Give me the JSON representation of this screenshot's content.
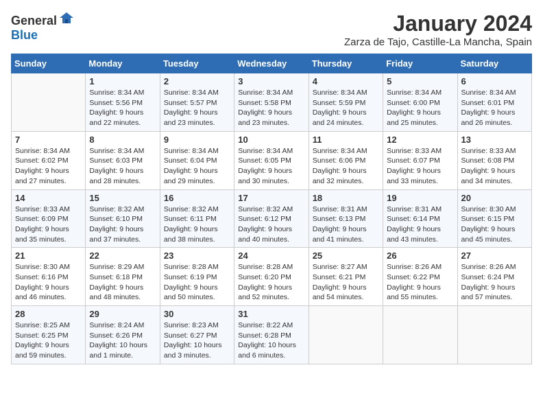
{
  "logo": {
    "general": "General",
    "blue": "Blue"
  },
  "title": "January 2024",
  "location": "Zarza de Tajo, Castille-La Mancha, Spain",
  "weekdays": [
    "Sunday",
    "Monday",
    "Tuesday",
    "Wednesday",
    "Thursday",
    "Friday",
    "Saturday"
  ],
  "weeks": [
    [
      {
        "day": "",
        "sunrise": "",
        "sunset": "",
        "daylight": ""
      },
      {
        "day": "1",
        "sunrise": "Sunrise: 8:34 AM",
        "sunset": "Sunset: 5:56 PM",
        "daylight": "Daylight: 9 hours and 22 minutes."
      },
      {
        "day": "2",
        "sunrise": "Sunrise: 8:34 AM",
        "sunset": "Sunset: 5:57 PM",
        "daylight": "Daylight: 9 hours and 23 minutes."
      },
      {
        "day": "3",
        "sunrise": "Sunrise: 8:34 AM",
        "sunset": "Sunset: 5:58 PM",
        "daylight": "Daylight: 9 hours and 23 minutes."
      },
      {
        "day": "4",
        "sunrise": "Sunrise: 8:34 AM",
        "sunset": "Sunset: 5:59 PM",
        "daylight": "Daylight: 9 hours and 24 minutes."
      },
      {
        "day": "5",
        "sunrise": "Sunrise: 8:34 AM",
        "sunset": "Sunset: 6:00 PM",
        "daylight": "Daylight: 9 hours and 25 minutes."
      },
      {
        "day": "6",
        "sunrise": "Sunrise: 8:34 AM",
        "sunset": "Sunset: 6:01 PM",
        "daylight": "Daylight: 9 hours and 26 minutes."
      }
    ],
    [
      {
        "day": "7",
        "sunrise": "Sunrise: 8:34 AM",
        "sunset": "Sunset: 6:02 PM",
        "daylight": "Daylight: 9 hours and 27 minutes."
      },
      {
        "day": "8",
        "sunrise": "Sunrise: 8:34 AM",
        "sunset": "Sunset: 6:03 PM",
        "daylight": "Daylight: 9 hours and 28 minutes."
      },
      {
        "day": "9",
        "sunrise": "Sunrise: 8:34 AM",
        "sunset": "Sunset: 6:04 PM",
        "daylight": "Daylight: 9 hours and 29 minutes."
      },
      {
        "day": "10",
        "sunrise": "Sunrise: 8:34 AM",
        "sunset": "Sunset: 6:05 PM",
        "daylight": "Daylight: 9 hours and 30 minutes."
      },
      {
        "day": "11",
        "sunrise": "Sunrise: 8:34 AM",
        "sunset": "Sunset: 6:06 PM",
        "daylight": "Daylight: 9 hours and 32 minutes."
      },
      {
        "day": "12",
        "sunrise": "Sunrise: 8:33 AM",
        "sunset": "Sunset: 6:07 PM",
        "daylight": "Daylight: 9 hours and 33 minutes."
      },
      {
        "day": "13",
        "sunrise": "Sunrise: 8:33 AM",
        "sunset": "Sunset: 6:08 PM",
        "daylight": "Daylight: 9 hours and 34 minutes."
      }
    ],
    [
      {
        "day": "14",
        "sunrise": "Sunrise: 8:33 AM",
        "sunset": "Sunset: 6:09 PM",
        "daylight": "Daylight: 9 hours and 35 minutes."
      },
      {
        "day": "15",
        "sunrise": "Sunrise: 8:32 AM",
        "sunset": "Sunset: 6:10 PM",
        "daylight": "Daylight: 9 hours and 37 minutes."
      },
      {
        "day": "16",
        "sunrise": "Sunrise: 8:32 AM",
        "sunset": "Sunset: 6:11 PM",
        "daylight": "Daylight: 9 hours and 38 minutes."
      },
      {
        "day": "17",
        "sunrise": "Sunrise: 8:32 AM",
        "sunset": "Sunset: 6:12 PM",
        "daylight": "Daylight: 9 hours and 40 minutes."
      },
      {
        "day": "18",
        "sunrise": "Sunrise: 8:31 AM",
        "sunset": "Sunset: 6:13 PM",
        "daylight": "Daylight: 9 hours and 41 minutes."
      },
      {
        "day": "19",
        "sunrise": "Sunrise: 8:31 AM",
        "sunset": "Sunset: 6:14 PM",
        "daylight": "Daylight: 9 hours and 43 minutes."
      },
      {
        "day": "20",
        "sunrise": "Sunrise: 8:30 AM",
        "sunset": "Sunset: 6:15 PM",
        "daylight": "Daylight: 9 hours and 45 minutes."
      }
    ],
    [
      {
        "day": "21",
        "sunrise": "Sunrise: 8:30 AM",
        "sunset": "Sunset: 6:16 PM",
        "daylight": "Daylight: 9 hours and 46 minutes."
      },
      {
        "day": "22",
        "sunrise": "Sunrise: 8:29 AM",
        "sunset": "Sunset: 6:18 PM",
        "daylight": "Daylight: 9 hours and 48 minutes."
      },
      {
        "day": "23",
        "sunrise": "Sunrise: 8:28 AM",
        "sunset": "Sunset: 6:19 PM",
        "daylight": "Daylight: 9 hours and 50 minutes."
      },
      {
        "day": "24",
        "sunrise": "Sunrise: 8:28 AM",
        "sunset": "Sunset: 6:20 PM",
        "daylight": "Daylight: 9 hours and 52 minutes."
      },
      {
        "day": "25",
        "sunrise": "Sunrise: 8:27 AM",
        "sunset": "Sunset: 6:21 PM",
        "daylight": "Daylight: 9 hours and 54 minutes."
      },
      {
        "day": "26",
        "sunrise": "Sunrise: 8:26 AM",
        "sunset": "Sunset: 6:22 PM",
        "daylight": "Daylight: 9 hours and 55 minutes."
      },
      {
        "day": "27",
        "sunrise": "Sunrise: 8:26 AM",
        "sunset": "Sunset: 6:24 PM",
        "daylight": "Daylight: 9 hours and 57 minutes."
      }
    ],
    [
      {
        "day": "28",
        "sunrise": "Sunrise: 8:25 AM",
        "sunset": "Sunset: 6:25 PM",
        "daylight": "Daylight: 9 hours and 59 minutes."
      },
      {
        "day": "29",
        "sunrise": "Sunrise: 8:24 AM",
        "sunset": "Sunset: 6:26 PM",
        "daylight": "Daylight: 10 hours and 1 minute."
      },
      {
        "day": "30",
        "sunrise": "Sunrise: 8:23 AM",
        "sunset": "Sunset: 6:27 PM",
        "daylight": "Daylight: 10 hours and 3 minutes."
      },
      {
        "day": "31",
        "sunrise": "Sunrise: 8:22 AM",
        "sunset": "Sunset: 6:28 PM",
        "daylight": "Daylight: 10 hours and 6 minutes."
      },
      {
        "day": "",
        "sunrise": "",
        "sunset": "",
        "daylight": ""
      },
      {
        "day": "",
        "sunrise": "",
        "sunset": "",
        "daylight": ""
      },
      {
        "day": "",
        "sunrise": "",
        "sunset": "",
        "daylight": ""
      }
    ]
  ]
}
